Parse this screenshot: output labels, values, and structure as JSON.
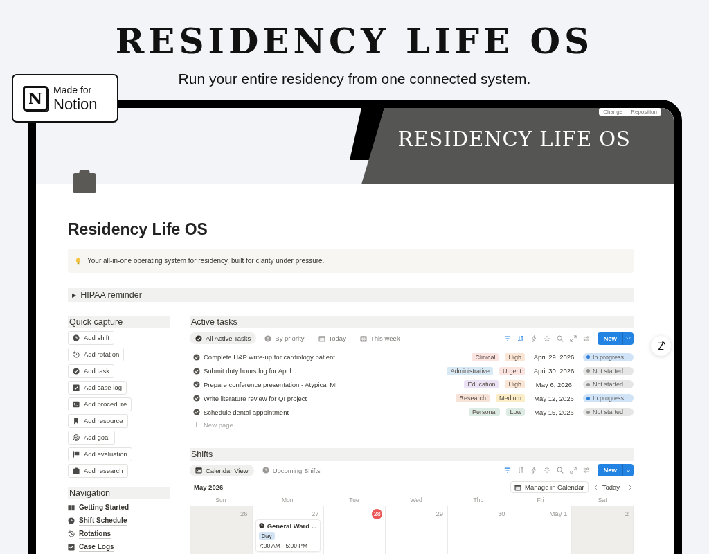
{
  "headline": "RESIDENCY LIFE OS",
  "tagline": "Run your entire residency from one connected system.",
  "badge": {
    "small": "Made for",
    "big": "Notion",
    "logo": "N"
  },
  "cover": {
    "title": "RESIDENCY LIFE OS",
    "buttons": [
      "Change",
      "Reposition"
    ]
  },
  "page": {
    "title": "Residency Life OS",
    "callout": "Your all-in-one operating system for residency, built for clarity under pressure.",
    "toggle": {
      "icon": "▶",
      "label": "HIPAA reminder",
      "expanded": false
    }
  },
  "quick_capture": {
    "title": "Quick capture",
    "buttons": [
      "Add shift",
      "Add rotation",
      "Add task",
      "Add case log",
      "Add procedure",
      "Add resource",
      "Add goal",
      "Add evaluation",
      "Add research"
    ]
  },
  "navigation": {
    "title": "Navigation",
    "links": [
      "Getting Started",
      "Shift Schedule",
      "Rotations",
      "Case Logs"
    ]
  },
  "tasks": {
    "title": "Active tasks",
    "views": [
      {
        "label": "All Active Tasks",
        "selected": true
      },
      {
        "label": "By priority",
        "selected": false
      },
      {
        "label": "Today",
        "selected": false
      },
      {
        "label": "This week",
        "selected": false
      }
    ],
    "toolbar": {
      "filter_active": true,
      "sort_active": true,
      "new_label": "New"
    },
    "rows": [
      {
        "name": "Complete H&P write-up for cardiology patient",
        "category": {
          "label": "Clinical",
          "color": "#fbe3e0"
        },
        "priority": {
          "label": "High",
          "color": "#fbe6d5"
        },
        "due": "April 29, 2026",
        "status": {
          "label": "In progress",
          "color": "#2e7fd6"
        }
      },
      {
        "name": "Submit duty hours log for April",
        "category": {
          "label": "Administrative",
          "color": "#d8e9f6"
        },
        "priority": {
          "label": "Urgent",
          "color": "#fbe3e0"
        },
        "due": "April 30, 2026",
        "status": {
          "label": "Not started",
          "color": "#8f8f8c"
        }
      },
      {
        "name": "Prepare conference presentation - Atypical MI",
        "category": {
          "label": "Education",
          "color": "#ece2f5"
        },
        "priority": {
          "label": "High",
          "color": "#fbe6d5"
        },
        "due": "May 6, 2026",
        "status": {
          "label": "Not started",
          "color": "#8f8f8c"
        }
      },
      {
        "name": "Write literature review for QI project",
        "category": {
          "label": "Research",
          "color": "#f6e2d6"
        },
        "priority": {
          "label": "Medium",
          "color": "#fbeec6"
        },
        "due": "May 12, 2026",
        "status": {
          "label": "In progress",
          "color": "#2e7fd6"
        }
      },
      {
        "name": "Schedule dental appointment",
        "category": {
          "label": "Personal",
          "color": "#dcebe3"
        },
        "priority": {
          "label": "Low",
          "color": "#dcebe3"
        },
        "due": "May 15, 2026",
        "status": {
          "label": "Not started",
          "color": "#8f8f8c"
        }
      }
    ],
    "new_page": "New page"
  },
  "shifts": {
    "title": "Shifts",
    "views": [
      {
        "label": "Calendar View",
        "selected": true
      },
      {
        "label": "Upcoming Shifts",
        "selected": false
      }
    ],
    "toolbar": {
      "filter_active": true,
      "sort_active": false,
      "new_label": "New"
    },
    "month": "May 2026",
    "manage": "Manage in Calendar",
    "today": "Today",
    "weekdays": [
      "Sun",
      "Mon",
      "Tue",
      "Wed",
      "Thu",
      "Fri",
      "Sat"
    ],
    "days": [
      {
        "day": "26",
        "weekend": true,
        "today": false
      },
      {
        "day": "27",
        "weekend": false,
        "today": false,
        "events": [
          {
            "title": "General Ward ...",
            "tag": "Day",
            "time": "7:00 AM - 5:00 PM"
          }
        ]
      },
      {
        "day": "28",
        "weekend": false,
        "today": true
      },
      {
        "day": "29",
        "weekend": false,
        "today": false
      },
      {
        "day": "30",
        "weekend": false,
        "today": false
      },
      {
        "day": "May 1",
        "weekend": false,
        "today": false
      },
      {
        "day": "2",
        "weekend": true,
        "today": false
      }
    ]
  }
}
